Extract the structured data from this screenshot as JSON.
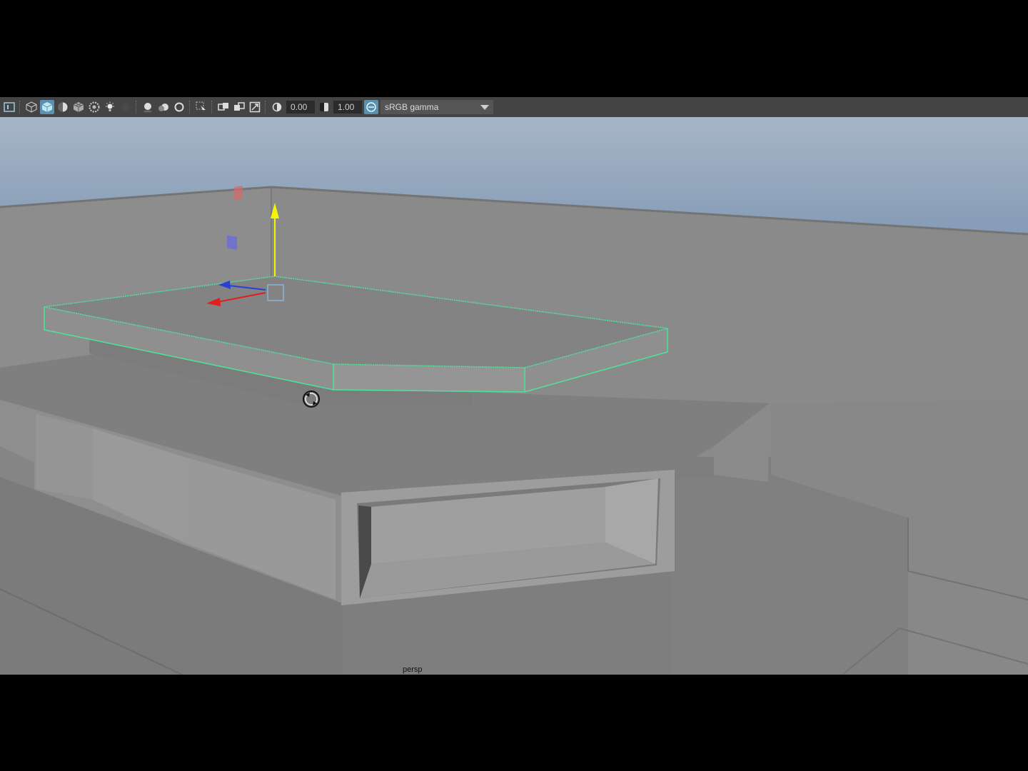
{
  "toolbar": {
    "exposure_value": "0.00",
    "gamma_value": "1.00",
    "color_management": "sRGB gamma",
    "icons": [
      "camera-attributes-icon",
      "wireframe-cube-icon",
      "smooth-shade-cube-icon",
      "default-material-icon",
      "textured-cube-icon",
      "xray-icon",
      "lights-icon",
      "shadows-icon",
      "ambient-occlusion-icon",
      "motion-blur-icon",
      "antialiasing-icon",
      "isolate-select-icon",
      "xray-joints-icon",
      "xray-active-icon",
      "backface-icon",
      "resolution-gate-icon",
      "exposure-icon",
      "gamma-icon",
      "color-management-icon"
    ],
    "accent_color": "#5d8fae"
  },
  "viewport": {
    "camera_label": "persp",
    "selection_color": "#4ee39a",
    "sky_color": "#8aa0b8",
    "background_color": "#8c8c8c"
  }
}
